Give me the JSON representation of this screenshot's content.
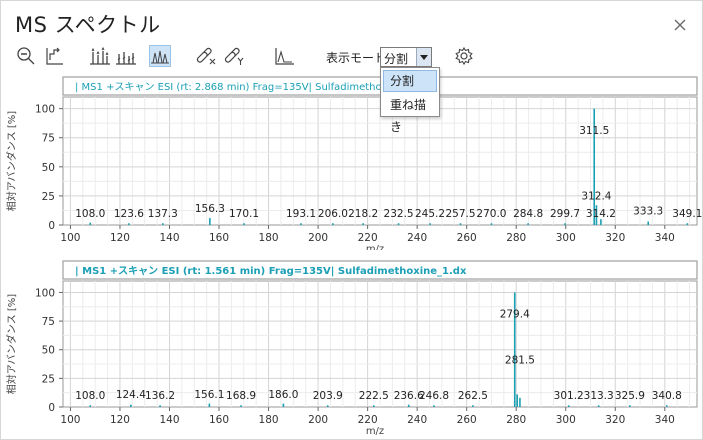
{
  "window": {
    "title": "MS スペクトル"
  },
  "toolbar": {
    "items": [
      {
        "name": "zoom-out-icon"
      },
      {
        "name": "autoscale-icon"
      },
      {
        "name": "peak-labels-icon"
      },
      {
        "name": "peak-labels-alt-icon"
      },
      {
        "name": "overlay-peaks-icon"
      },
      {
        "name": "unlink-x-icon"
      },
      {
        "name": "unlink-y-icon"
      },
      {
        "name": "spectrum-view-icon"
      },
      {
        "name": "settings-icon"
      }
    ],
    "mode_label": "表示モード",
    "mode_value": "分割",
    "mode_options": [
      "分割",
      "重ね描き"
    ]
  },
  "chart_data": [
    {
      "type": "bar",
      "title": "| MS1 +スキャン ESI (rt: 2.868 min) Frag=135V| Sulfadimethoxine",
      "xlabel": "m/z",
      "ylabel": "相対アバンダンス [%]",
      "xlim": [
        97,
        353
      ],
      "ylim": [
        0,
        110
      ],
      "xticks": [
        100,
        120,
        140,
        160,
        180,
        200,
        220,
        240,
        260,
        280,
        300,
        320,
        340
      ],
      "yticks": [
        0,
        25,
        50,
        75,
        100
      ],
      "grid": true,
      "color": "#1aa0b4",
      "peaks": [
        {
          "mz": 108.0,
          "y": 2
        },
        {
          "mz": 123.6,
          "y": 1.5
        },
        {
          "mz": 137.3,
          "y": 1.5
        },
        {
          "mz": 156.3,
          "y": 6
        },
        {
          "mz": 170.1,
          "y": 1.5
        },
        {
          "mz": 193.1,
          "y": 1.5
        },
        {
          "mz": 206.0,
          "y": 1.5
        },
        {
          "mz": 218.2,
          "y": 1.5
        },
        {
          "mz": 232.5,
          "y": 1.5
        },
        {
          "mz": 245.2,
          "y": 1.5
        },
        {
          "mz": 257.5,
          "y": 1.5
        },
        {
          "mz": 270.0,
          "y": 1.5
        },
        {
          "mz": 284.8,
          "y": 1.5
        },
        {
          "mz": 299.7,
          "y": 1.5
        },
        {
          "mz": 311.5,
          "y": 100
        },
        {
          "mz": 312.4,
          "y": 17
        },
        {
          "mz": 314.2,
          "y": 5
        },
        {
          "mz": 333.3,
          "y": 3
        },
        {
          "mz": 349.1,
          "y": 1.5
        }
      ],
      "labels": [
        {
          "mz": 108.0,
          "text": "108.0",
          "y": 7
        },
        {
          "mz": 123.6,
          "text": "123.6",
          "y": 7
        },
        {
          "mz": 137.3,
          "text": "137.3",
          "y": 7
        },
        {
          "mz": 156.3,
          "text": "156.3",
          "y": 11
        },
        {
          "mz": 170.1,
          "text": "170.1",
          "y": 7
        },
        {
          "mz": 193.1,
          "text": "193.1",
          "y": 7
        },
        {
          "mz": 206.0,
          "text": "206.0",
          "y": 7
        },
        {
          "mz": 218.2,
          "text": "218.2",
          "y": 7
        },
        {
          "mz": 232.5,
          "text": "232.5",
          "y": 7
        },
        {
          "mz": 245.2,
          "text": "245.2",
          "y": 7
        },
        {
          "mz": 257.5,
          "text": "257.5",
          "y": 7
        },
        {
          "mz": 270.0,
          "text": "270.0",
          "y": 7
        },
        {
          "mz": 284.8,
          "text": "284.8",
          "y": 7
        },
        {
          "mz": 299.7,
          "text": "299.7",
          "y": 7
        },
        {
          "mz": 311.5,
          "text": "311.5",
          "y": 78
        },
        {
          "mz": 312.4,
          "text": "312.4",
          "y": 22
        },
        {
          "mz": 314.2,
          "text": "314.2",
          "y": 7
        },
        {
          "mz": 333.3,
          "text": "333.3",
          "y": 9
        },
        {
          "mz": 349.1,
          "text": "349.1",
          "y": 7
        }
      ]
    },
    {
      "type": "bar",
      "title": "| MS1 +スキャン ESI (rt: 1.561 min) Frag=135V| Sulfadimethoxine_1.dx",
      "xlabel": "m/z",
      "ylabel": "相対アバンダンス [%]",
      "xlim": [
        97,
        353
      ],
      "ylim": [
        0,
        110
      ],
      "xticks": [
        100,
        120,
        140,
        160,
        180,
        200,
        220,
        240,
        260,
        280,
        300,
        320,
        340
      ],
      "yticks": [
        0,
        25,
        50,
        75,
        100
      ],
      "grid": true,
      "color": "#1aa0b4",
      "peaks": [
        {
          "mz": 108.0,
          "y": 1.5
        },
        {
          "mz": 124.4,
          "y": 2
        },
        {
          "mz": 136.2,
          "y": 1.5
        },
        {
          "mz": 156.1,
          "y": 3
        },
        {
          "mz": 168.9,
          "y": 1.5
        },
        {
          "mz": 186.0,
          "y": 3
        },
        {
          "mz": 203.9,
          "y": 1.5
        },
        {
          "mz": 222.5,
          "y": 1.5
        },
        {
          "mz": 236.6,
          "y": 2
        },
        {
          "mz": 246.8,
          "y": 1.5
        },
        {
          "mz": 262.5,
          "y": 1.5
        },
        {
          "mz": 279.4,
          "y": 100
        },
        {
          "mz": 280.4,
          "y": 11
        },
        {
          "mz": 281.5,
          "y": 8
        },
        {
          "mz": 301.2,
          "y": 1.5
        },
        {
          "mz": 313.3,
          "y": 1.5
        },
        {
          "mz": 325.9,
          "y": 1.5
        },
        {
          "mz": 340.8,
          "y": 1.5
        }
      ],
      "labels": [
        {
          "mz": 108.0,
          "text": "108.0",
          "y": 7
        },
        {
          "mz": 124.4,
          "text": "124.4",
          "y": 8
        },
        {
          "mz": 136.2,
          "text": "136.2",
          "y": 7
        },
        {
          "mz": 156.1,
          "text": "156.1",
          "y": 8
        },
        {
          "mz": 168.9,
          "text": "168.9",
          "y": 7
        },
        {
          "mz": 186.0,
          "text": "186.0",
          "y": 8
        },
        {
          "mz": 203.9,
          "text": "203.9",
          "y": 7
        },
        {
          "mz": 222.5,
          "text": "222.5",
          "y": 7
        },
        {
          "mz": 236.6,
          "text": "236.6",
          "y": 7
        },
        {
          "mz": 246.8,
          "text": "246.8",
          "y": 7
        },
        {
          "mz": 262.5,
          "text": "262.5",
          "y": 7
        },
        {
          "mz": 279.4,
          "text": "279.4",
          "y": 78
        },
        {
          "mz": 281.5,
          "text": "281.5",
          "y": 38
        },
        {
          "mz": 301.2,
          "text": "301.2",
          "y": 7
        },
        {
          "mz": 313.3,
          "text": "313.3",
          "y": 7
        },
        {
          "mz": 325.9,
          "text": "325.9",
          "y": 7
        },
        {
          "mz": 340.8,
          "text": "340.8",
          "y": 7
        }
      ]
    }
  ]
}
